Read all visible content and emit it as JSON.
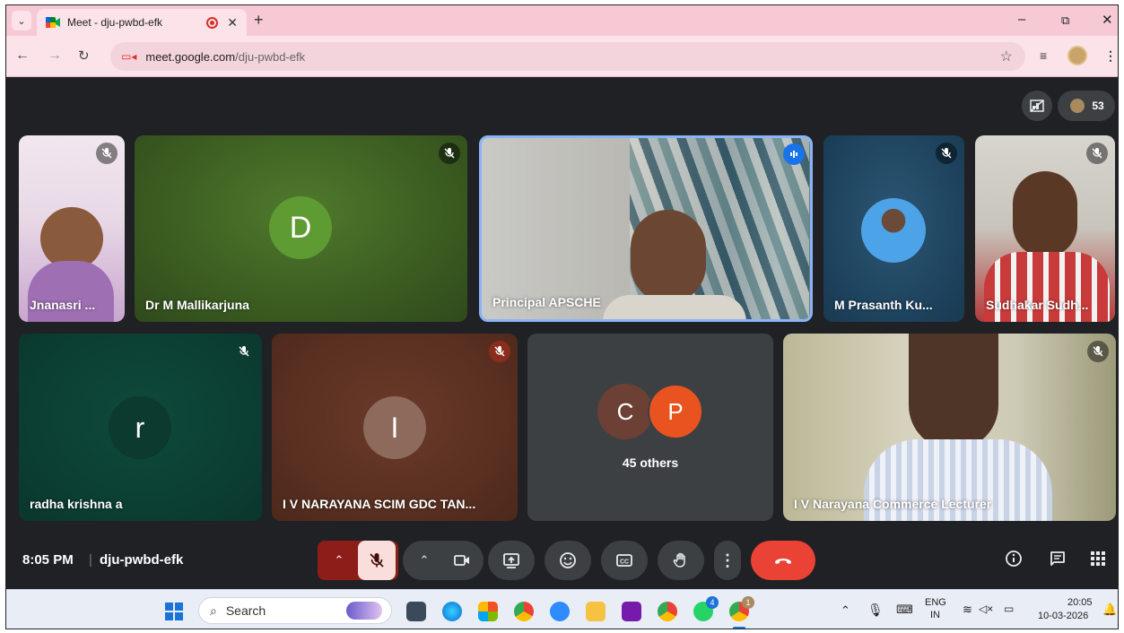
{
  "browser": {
    "tab_title": "Meet - dju-pwbd-efk",
    "url_host": "meet.google.com",
    "url_path": "/dju-pwbd-efk",
    "minimize": "–",
    "restore": "⧉",
    "close": "✕"
  },
  "meet": {
    "participant_count": "53",
    "time": "8:05 PM",
    "separator": "|",
    "meeting_code": "dju-pwbd-efk",
    "others_label": "45 others",
    "others_avatars": [
      "C",
      "P"
    ],
    "tiles": [
      {
        "name": "Jnanasri ...",
        "muted": true
      },
      {
        "name": "Dr M Mallikarjuna",
        "initial": "D",
        "muted": true
      },
      {
        "name": "Principal APSCHE",
        "speaking": true
      },
      {
        "name": "M Prasanth Ku...",
        "muted": true
      },
      {
        "name": "Sudhakar Sudh...",
        "muted": true
      },
      {
        "name": "radha krishna a",
        "initial": "r",
        "muted": true
      },
      {
        "name": "I V NARAYANA SCIM GDC TAN...",
        "initial": "I",
        "muted": true
      },
      {
        "name": "I V Narayana Commerce Lecturer",
        "muted": true
      }
    ],
    "colors": {
      "end_call": "#ea4335",
      "mic_off": "#f9dedc",
      "speaking_border": "#8ab4f8"
    }
  },
  "taskbar": {
    "search_label": "Search",
    "lang_top": "ENG",
    "lang_bottom": "IN",
    "clock_time": "20:05",
    "clock_date": "10-03-2026",
    "whatsapp_badge": "4",
    "chrome_badge": "1"
  }
}
